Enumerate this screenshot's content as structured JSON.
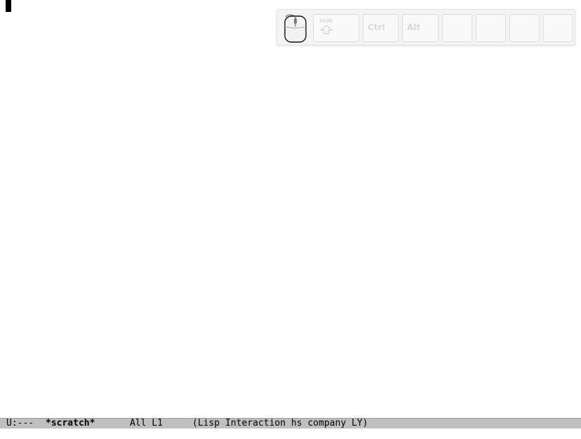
{
  "modeline": {
    "status": "U:---",
    "buffer_name": "*scratch*",
    "position": "All L1",
    "modes": "(Lisp Interaction hs company LY)"
  },
  "keycast": {
    "keys": [
      {
        "name": "shift",
        "label": "Shift"
      },
      {
        "name": "ctrl",
        "label": "Ctrl"
      },
      {
        "name": "alt",
        "label": "Alt"
      },
      {
        "name": "blank-1",
        "label": ""
      },
      {
        "name": "blank-2",
        "label": ""
      },
      {
        "name": "blank-3",
        "label": ""
      },
      {
        "name": "blank-4",
        "label": ""
      }
    ]
  },
  "colors": {
    "modeline_bg": "#bfbfbf",
    "cursor": "#000000",
    "key_text": "#d9d9d9"
  }
}
